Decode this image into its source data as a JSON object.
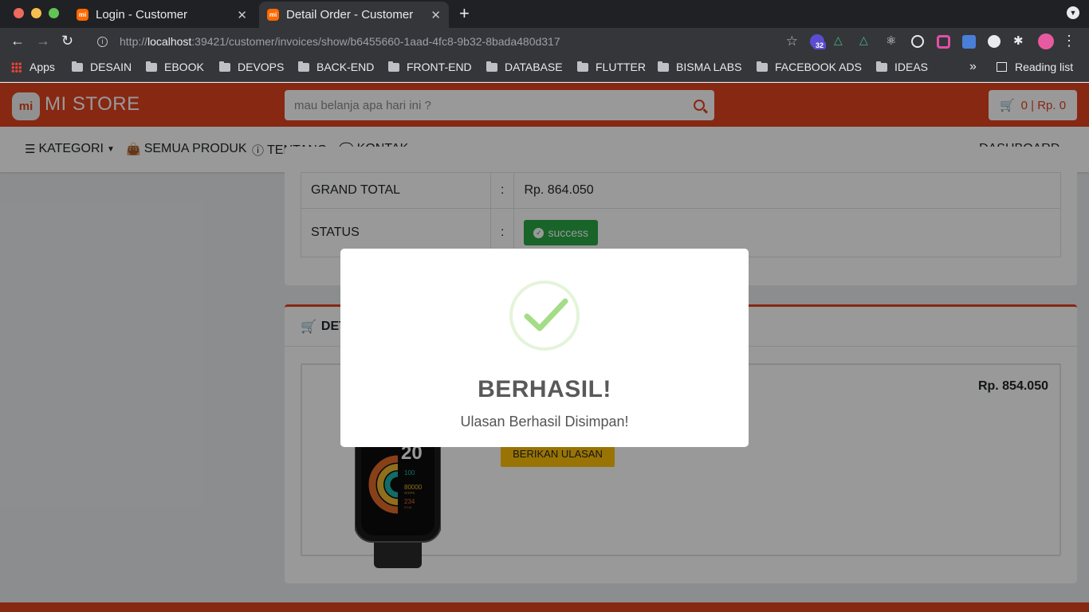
{
  "browser": {
    "tabs": [
      {
        "title": "Login - Customer",
        "favicon": "mi",
        "active": false
      },
      {
        "title": "Detail Order - Customer",
        "favicon": "mi",
        "active": true
      }
    ],
    "url_scheme": "http://",
    "url_host": "localhost",
    "url_rest": ":39421/customer/invoices/show/b6455660-1aad-4fc8-9b32-8bada480d317",
    "extension_badge": "32",
    "bookmarks": [
      "Apps",
      "DESAIN",
      "EBOOK",
      "DEVOPS",
      "BACK-END",
      "FRONT-END",
      "DATABASE",
      "FLUTTER",
      "BISMA LABS",
      "FACEBOOK ADS",
      "IDEAS"
    ],
    "reading_list": "Reading list"
  },
  "store": {
    "logo_mark": "mi",
    "brand": "MI STORE",
    "search_placeholder": "mau belanja apa hari ini ?",
    "cart_text": "0 | Rp. 0",
    "accent_color": "#e1441e"
  },
  "nav": {
    "kategori": "KATEGORI",
    "semua_produk": "SEMUA PRODUK",
    "tentang": "TENTANG",
    "kontak": "KONTAK",
    "dashboard": "DASHBOARD"
  },
  "order": {
    "grand_total_label": "GRAND TOTAL",
    "grand_total_value": "Rp. 864.050",
    "status_label": "STATUS",
    "status_value": "success",
    "separator": ":"
  },
  "detail": {
    "heading_visible": "DET",
    "item_price": "Rp. 854.050",
    "review_button": "BERIKAN ULASAN"
  },
  "watch_face": {
    "time": "20",
    "stat1": "100",
    "stat2": "80000",
    "stat2_unit": "STEPS",
    "stat3": "234",
    "stat3_unit": "KCAL"
  },
  "modal": {
    "title": "BERHASIL!",
    "text": "Ulasan Berhasil Disimpan!"
  }
}
